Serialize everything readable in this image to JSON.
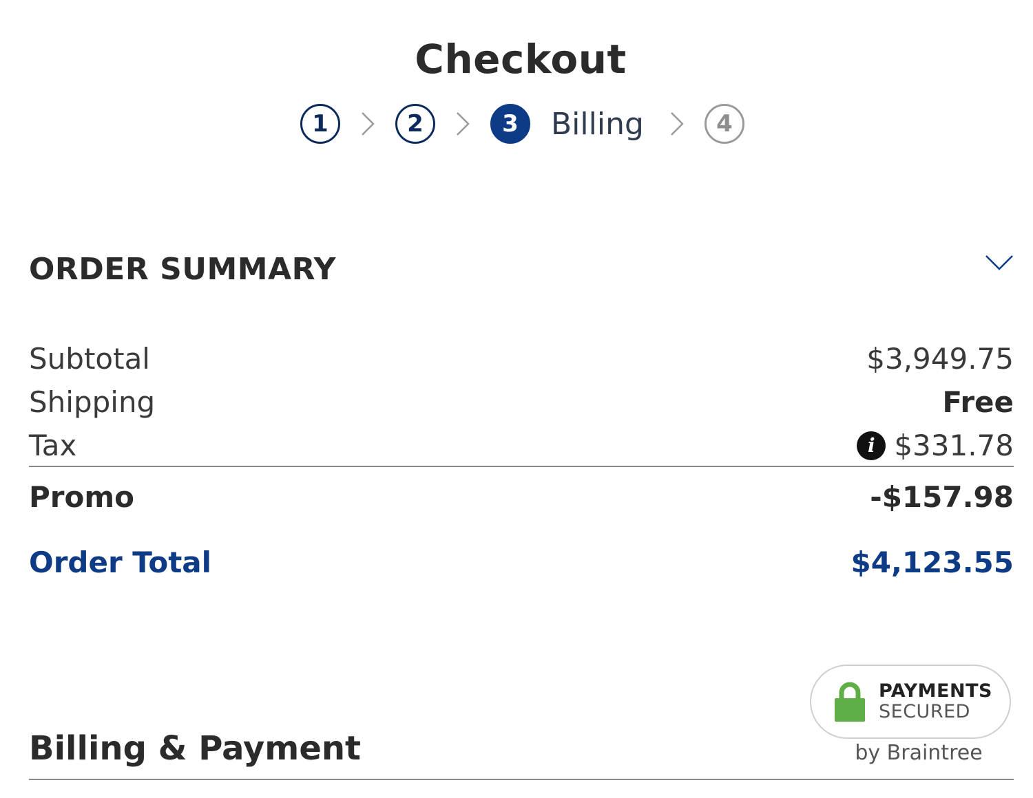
{
  "header": {
    "title": "Checkout"
  },
  "stepper": {
    "steps": [
      {
        "number": "1",
        "state": "completed"
      },
      {
        "number": "2",
        "state": "completed"
      },
      {
        "number": "3",
        "state": "active",
        "label": "Billing"
      },
      {
        "number": "4",
        "state": "upcoming"
      }
    ]
  },
  "summary": {
    "title": "ORDER SUMMARY",
    "rows": [
      {
        "label": "Subtotal",
        "value": "$3,949.75"
      },
      {
        "label": "Shipping",
        "value": "Free"
      },
      {
        "label": "Tax",
        "value": "$331.78"
      }
    ],
    "promo": {
      "label": "Promo",
      "value": "-$157.98"
    },
    "total": {
      "label": "Order Total",
      "value": "$4,123.55"
    }
  },
  "billing": {
    "title": "Billing & Payment"
  },
  "badge": {
    "line1": "PAYMENTS",
    "line2": "SECURED",
    "provider": "by Braintree"
  },
  "colors": {
    "brand_blue": "#0d3b85",
    "dark_navy": "#0d2a5c",
    "text_dark": "#2b2b2b",
    "lock_green": "#5fae46",
    "disabled_gray": "#9a9a9a"
  },
  "icons": {
    "step_separator": "chevron-right-icon",
    "collapse": "chevron-down-icon",
    "tax_info": "info-icon",
    "badge": "padlock-icon"
  }
}
